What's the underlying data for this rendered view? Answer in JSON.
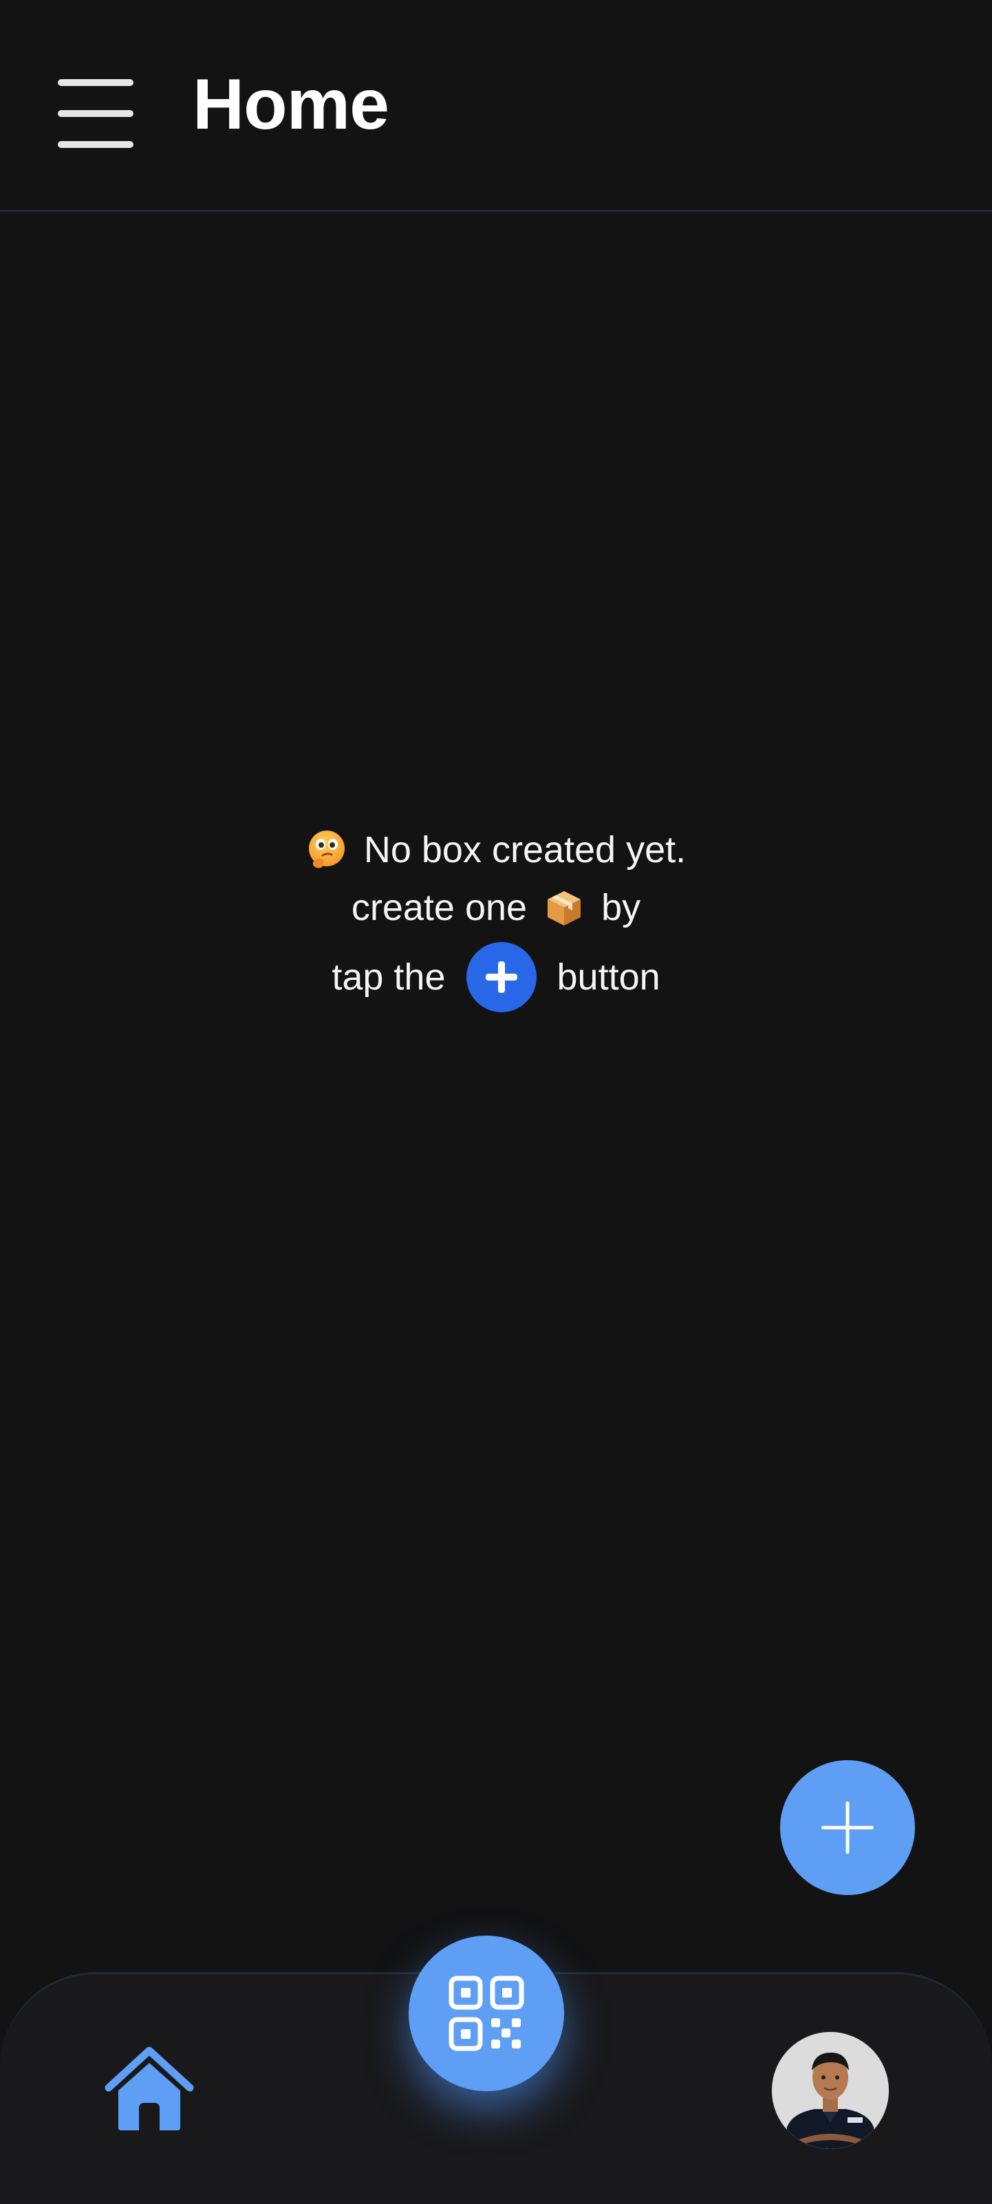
{
  "header": {
    "title": "Home",
    "menu_icon": "hamburger-menu-icon"
  },
  "empty_state": {
    "line1_icon": "thinking-face-emoji",
    "line1_text": "No box created yet.",
    "line2_before": "create one",
    "line2_icon": "package-box-emoji",
    "line2_after": "by",
    "line3_before": "tap the",
    "line3_icon": "plus-circle-icon",
    "line3_after": "button"
  },
  "fab": {
    "icon": "plus-icon"
  },
  "bottom_nav": {
    "home_icon": "home-icon",
    "scan_icon": "qr-code-icon",
    "profile_icon": "avatar"
  },
  "colors": {
    "background": "#131314",
    "accent": "#5e9ff5",
    "inline_button": "#2767e8",
    "nav_background": "#19191b"
  }
}
